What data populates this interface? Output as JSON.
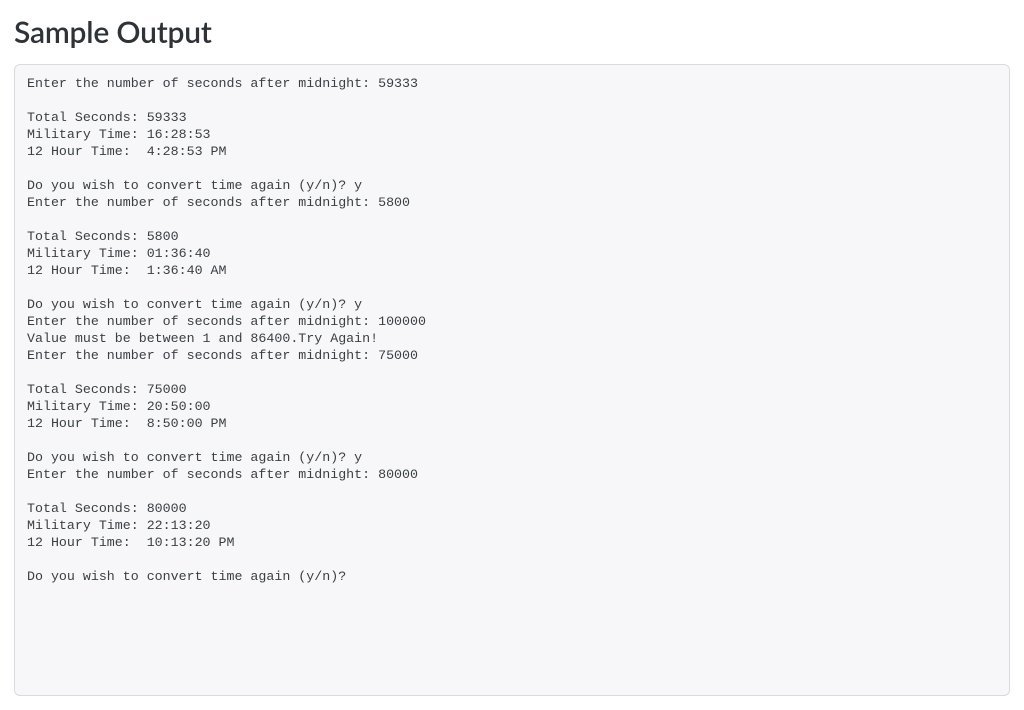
{
  "heading": "Sample Output",
  "output_lines": [
    "Enter the number of seconds after midnight: 59333",
    "",
    "Total Seconds: 59333",
    "Military Time: 16:28:53",
    "12 Hour Time:  4:28:53 PM",
    "",
    "Do you wish to convert time again (y/n)? y",
    "Enter the number of seconds after midnight: 5800",
    "",
    "Total Seconds: 5800",
    "Military Time: 01:36:40",
    "12 Hour Time:  1:36:40 AM",
    "",
    "Do you wish to convert time again (y/n)? y",
    "Enter the number of seconds after midnight: 100000",
    "Value must be between 1 and 86400.Try Again!",
    "Enter the number of seconds after midnight: 75000",
    "",
    "Total Seconds: 75000",
    "Military Time: 20:50:00",
    "12 Hour Time:  8:50:00 PM",
    "",
    "Do you wish to convert time again (y/n)? y",
    "Enter the number of seconds after midnight: 80000",
    "",
    "Total Seconds: 80000",
    "Military Time: 22:13:20",
    "12 Hour Time:  10:13:20 PM",
    "",
    "Do you wish to convert time again (y/n)?"
  ]
}
